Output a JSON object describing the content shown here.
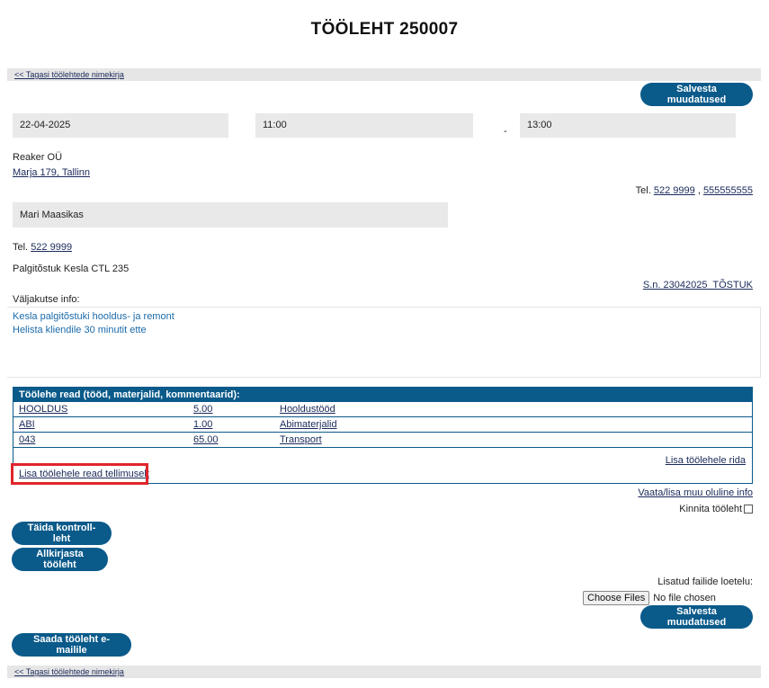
{
  "page_title": "TÖÖLEHT 250007",
  "back_link": "<< Tagasi töölehtede nimekirja",
  "save_button": "Salvesta muudatused",
  "date": "22-04-2025",
  "time_start": "11:00",
  "time_sep": "-",
  "time_end": "13:00",
  "customer": {
    "company": "Reaker OÜ",
    "address": "Marja 179, Tallinn",
    "tel_prefix": "Tel.",
    "phone1": "522 9999",
    "phone_sep": ",",
    "phone2": "555555555"
  },
  "contact": {
    "name": "Mari Maasikas",
    "tel_prefix": "Tel.",
    "phone": "522 9999"
  },
  "equipment": {
    "name": "Palgitõstuk Kesla CTL 235",
    "serial": "S.n. 23042025  TÕSTUK"
  },
  "callout": {
    "label": "Väljakutse info:",
    "lines": [
      "Kesla palgitõstuki hooldus- ja remont",
      "Helista kliendile 30 minutit ette"
    ]
  },
  "rows": {
    "header": "Töölehe read (tööd, materjalid, kommentaarid):",
    "items": [
      {
        "code": "HOOLDUS",
        "qty": "5.00",
        "desc": "Hooldustööd"
      },
      {
        "code": "ABI",
        "qty": "1.00",
        "desc": "Abimaterjalid"
      },
      {
        "code": "043",
        "qty": "65.00",
        "desc": "Transport"
      }
    ],
    "add_row": "Lisa töölehele rida",
    "add_from_order": "Lisa töölehele read tellimuselt"
  },
  "other_info_link": "Vaata/lisa muu oluline info",
  "confirm_label": "Kinnita tööleht",
  "buttons": {
    "checklist": "Täida kontroll-leht",
    "sign": "Allkirjasta tööleht",
    "email": "Saada tööleht e-mailile"
  },
  "files": {
    "label": "Lisatud failide loetelu:",
    "choose": "Choose Files",
    "none": "No file chosen"
  }
}
